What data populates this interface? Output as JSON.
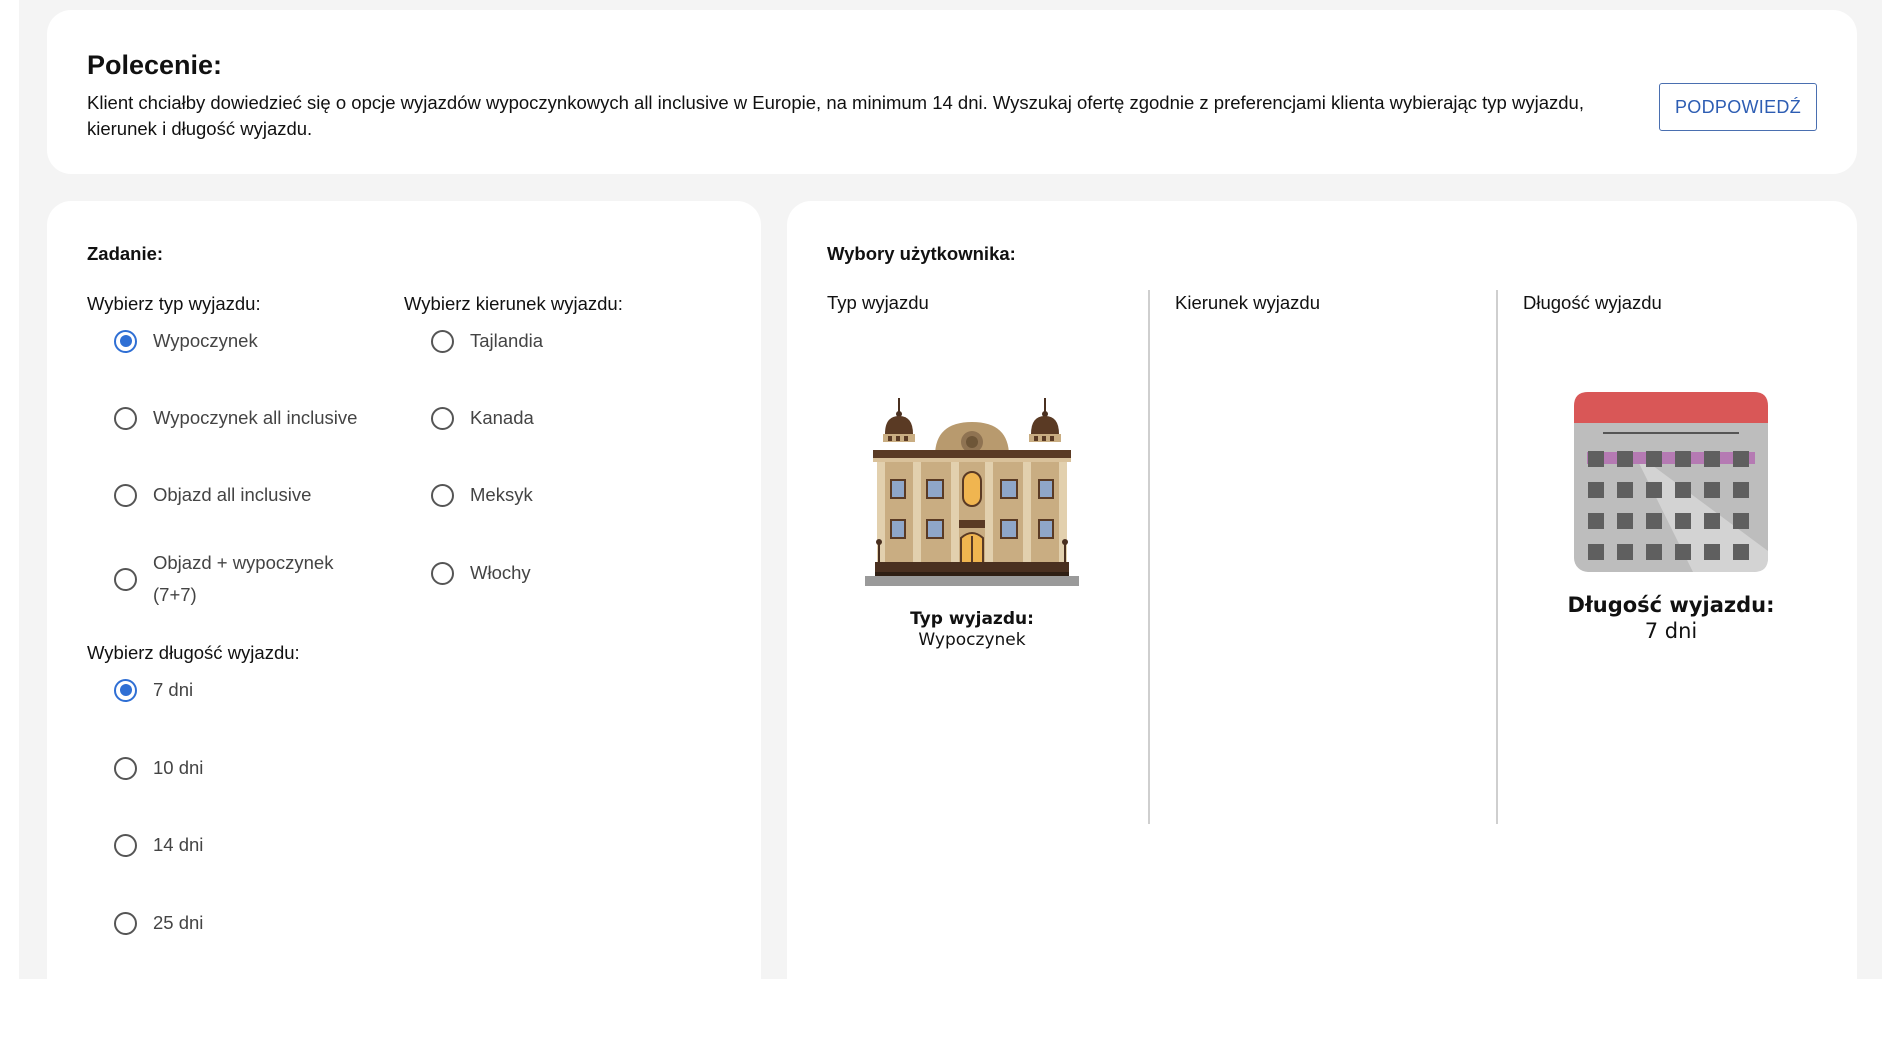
{
  "instruction": {
    "title": "Polecenie:",
    "text": "Klient chciałby dowiedzieć się o opcje wyjazdów wypoczynkowych all inclusive w Europie, na minimum 14 dni. Wyszukaj ofertę zgodnie z preferencjami klienta wybierając typ wyjazdu, kierunek i długość wyjazdu.",
    "hint_label": "PODPOWIEDŹ"
  },
  "task": {
    "title": "Zadanie:",
    "trip_type": {
      "label": "Wybierz typ wyjazdu:",
      "selected": "Wypoczynek",
      "options": [
        "Wypoczynek",
        "Wypoczynek all inclusive",
        "Objazd all inclusive",
        "Objazd + wypoczynek",
        "(7+7)"
      ]
    },
    "direction": {
      "label": "Wybierz kierunek wyjazdu:",
      "selected": null,
      "options": [
        "Tajlandia",
        "Kanada",
        "Meksyk",
        "Włochy"
      ]
    },
    "duration": {
      "label": "Wybierz długość wyjazdu:",
      "selected": "7 dni",
      "options": [
        "7 dni",
        "10 dni",
        "14 dni",
        "25 dni"
      ]
    }
  },
  "choices": {
    "title": "Wybory użytkownika:",
    "columns": [
      "Typ wyjazdu",
      "Kierunek wyjazdu",
      "Długość wyjazdu"
    ],
    "trip_type_caption": "Typ wyjazdu:",
    "trip_type_value": "Wypoczynek",
    "duration_caption": "Długość wyjazdu:",
    "duration_value": "7 dni"
  },
  "colors": {
    "accent": "#2f6fd4",
    "hint_text": "#2d5db3",
    "page_bg": "#f4f4f4",
    "calendar_top": "#d95757",
    "calendar_body": "#b9b9b9"
  },
  "icons": [
    "hotel-icon",
    "calendar-icon"
  ]
}
